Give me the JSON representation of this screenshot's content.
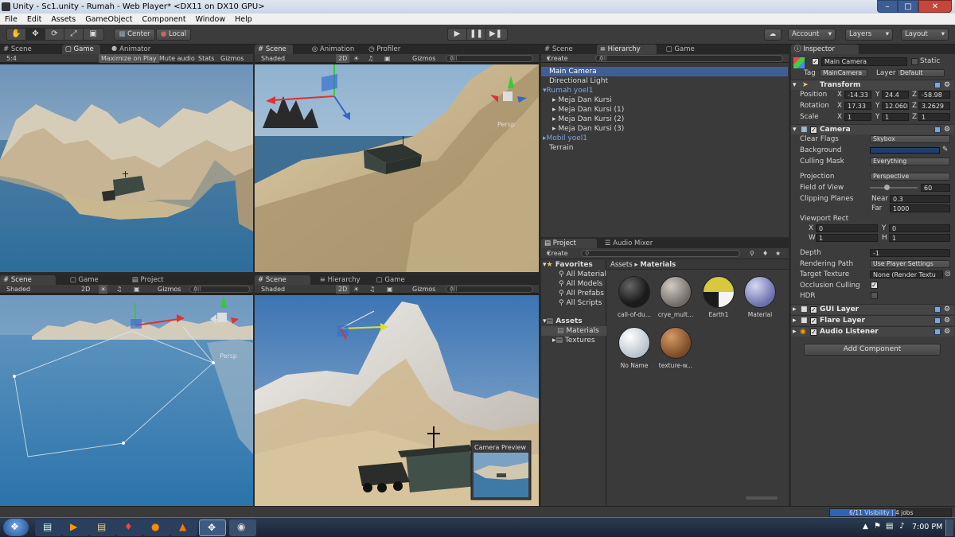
{
  "window": {
    "title": "Unity - Sc1.unity - Rumah - Web Player* <DX11 on DX10 GPU>"
  },
  "menu": [
    "File",
    "Edit",
    "Assets",
    "GameObject",
    "Component",
    "Window",
    "Help"
  ],
  "toolbar": {
    "pivot_label": "Center",
    "space_label": "Local",
    "account_label": "Account",
    "layers_label": "Layers",
    "layout_label": "Layout"
  },
  "panel_tl": {
    "tabs": [
      "Scene",
      "Game",
      "Animator"
    ],
    "aspect": "5:4",
    "maximize": "Maximize on Play",
    "mute": "Mute audio",
    "stats": "Stats",
    "gizmos": "Gizmos"
  },
  "panel_tm": {
    "tabs": [
      "Scene",
      "Animation",
      "Profiler"
    ],
    "shaded": "Shaded",
    "mode2d": "2D",
    "gizmos": "Gizmos",
    "search": "All",
    "persp": "Persp"
  },
  "panel_bl": {
    "tabs": [
      "Scene",
      "Game",
      "Project"
    ],
    "shaded": "Shaded",
    "mode2d": "2D",
    "gizmos": "Gizmos",
    "search": "All",
    "persp": "Persp"
  },
  "panel_bm": {
    "tabs": [
      "Scene",
      "Hierarchy",
      "Game"
    ],
    "shaded": "Shaded",
    "mode2d": "2D",
    "gizmos": "Gizmos",
    "search": "All",
    "camera_preview": "Camera Preview"
  },
  "hierarchy": {
    "tabs": [
      "Scene",
      "Hierarchy",
      "Game"
    ],
    "create": "Create",
    "search": "All",
    "items": [
      {
        "label": "Main Camera",
        "indent": 0,
        "selected": true
      },
      {
        "label": "Directional Light",
        "indent": 0
      },
      {
        "label": "Rumah yoel1",
        "indent": 0,
        "prefab": true,
        "expanded": true
      },
      {
        "label": "Meja Dan Kursi",
        "indent": 1
      },
      {
        "label": "Meja Dan Kursi (1)",
        "indent": 1
      },
      {
        "label": "Meja Dan Kursi (2)",
        "indent": 1
      },
      {
        "label": "Meja Dan Kursi (3)",
        "indent": 1
      },
      {
        "label": "Mobil yoel1",
        "indent": 0,
        "prefab": true
      },
      {
        "label": "Terrain",
        "indent": 0
      }
    ]
  },
  "project": {
    "tabs": [
      "Project",
      "Audio Mixer"
    ],
    "create": "Create",
    "breadcrumb": [
      "Assets",
      "Materials"
    ],
    "favorites_title": "Favorites",
    "favorites": [
      "All Material",
      "All Models",
      "All Prefabs",
      "All Scripts"
    ],
    "assets_title": "Assets",
    "folders": [
      "Materials",
      "Textures"
    ],
    "assets": [
      {
        "name": "call-of-du...",
        "color": "#1b1b1b"
      },
      {
        "name": "crye_mult...",
        "color": "#8a8680"
      },
      {
        "name": "Earth1",
        "color": "#d8c840"
      },
      {
        "name": "Material",
        "color": "#8a8ecc"
      },
      {
        "name": "No Name",
        "color": "#e6eaf0"
      },
      {
        "name": "texture-w...",
        "color": "#a0693c"
      }
    ]
  },
  "inspector": {
    "tab": "Inspector",
    "object_name": "Main Camera",
    "static_label": "Static",
    "tag_label": "Tag",
    "tag_value": "MainCamera",
    "layer_label": "Layer",
    "layer_value": "Default",
    "transform": {
      "title": "Transform",
      "position_label": "Position",
      "rotation_label": "Rotation",
      "scale_label": "Scale",
      "position": {
        "x": "-14.33",
        "y": "24.4",
        "z": "-58.98"
      },
      "rotation": {
        "x": "17.33",
        "y": "12.0608",
        "z": "3.2629"
      },
      "scale": {
        "x": "1",
        "y": "1",
        "z": "1"
      }
    },
    "camera": {
      "title": "Camera",
      "clear_flags_label": "Clear Flags",
      "clear_flags": "Skybox",
      "background_label": "Background",
      "background_color": "#1f3f6e",
      "culling_mask_label": "Culling Mask",
      "culling_mask": "Everything",
      "projection_label": "Projection",
      "projection": "Perspective",
      "fov_label": "Field of View",
      "fov": "60",
      "clipping_label": "Clipping Planes",
      "near_label": "Near",
      "near": "0.3",
      "far_label": "Far",
      "far": "1000",
      "viewport_label": "Viewport Rect",
      "vp": {
        "x": "0",
        "y": "0",
        "w": "1",
        "h": "1"
      },
      "depth_label": "Depth",
      "depth": "-1",
      "rendering_path_label": "Rendering Path",
      "rendering_path": "Use Player Settings",
      "target_texture_label": "Target Texture",
      "target_texture": "None (Render Textu",
      "occlusion_label": "Occlusion Culling",
      "hdr_label": "HDR"
    },
    "components": [
      "GUI Layer",
      "Flare Layer",
      "Audio Listener"
    ],
    "add_component": "Add Component"
  },
  "status": {
    "visibility": "6/11 Visibility | 4 jobs"
  },
  "taskbar": {
    "time": "7:00 PM"
  },
  "colors": {
    "selection": "#3e5f96",
    "prefab_text": "#7fa2e6",
    "accent": "#3e5f96"
  }
}
